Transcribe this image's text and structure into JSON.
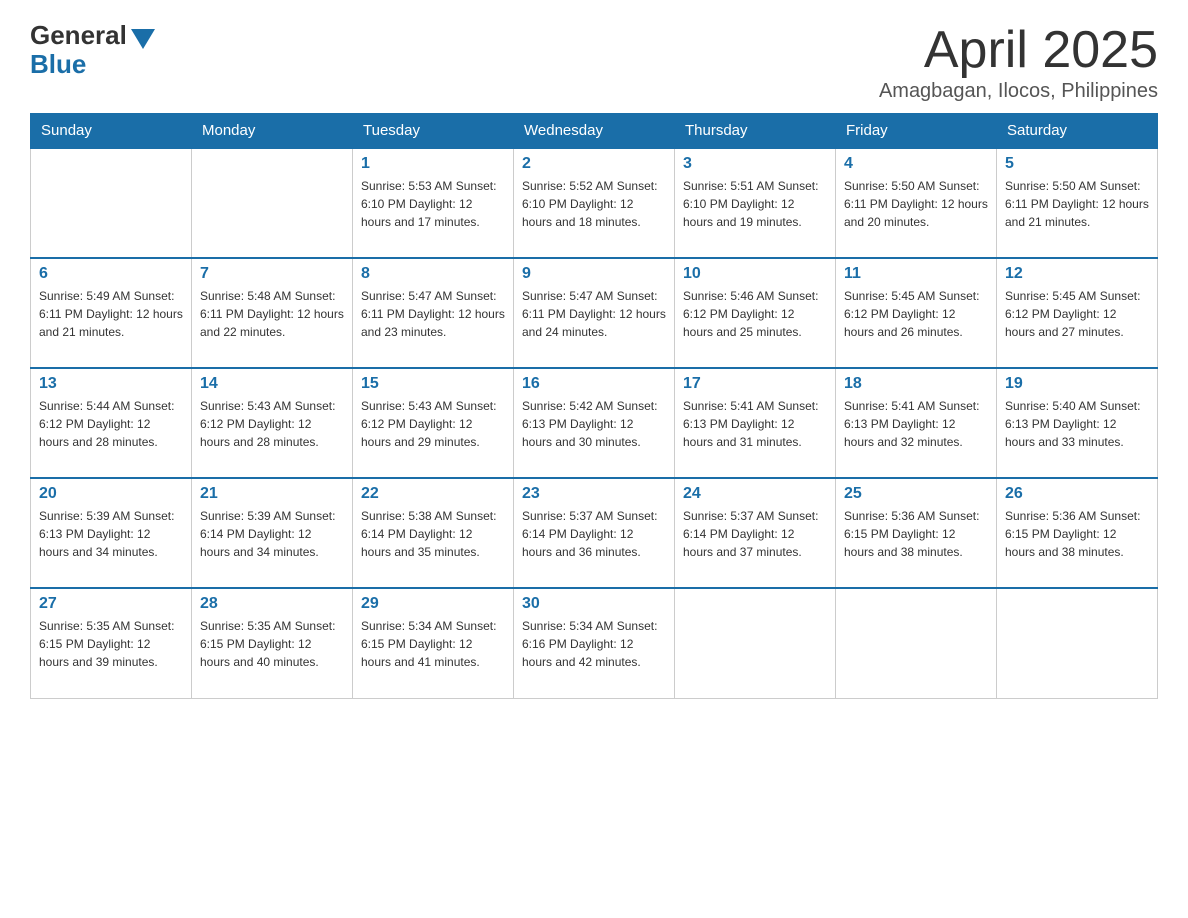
{
  "header": {
    "logo_general": "General",
    "logo_blue": "Blue",
    "month_title": "April 2025",
    "location": "Amagbagan, Ilocos, Philippines"
  },
  "days_of_week": [
    "Sunday",
    "Monday",
    "Tuesday",
    "Wednesday",
    "Thursday",
    "Friday",
    "Saturday"
  ],
  "weeks": [
    [
      {
        "day": "",
        "info": ""
      },
      {
        "day": "",
        "info": ""
      },
      {
        "day": "1",
        "info": "Sunrise: 5:53 AM\nSunset: 6:10 PM\nDaylight: 12 hours\nand 17 minutes."
      },
      {
        "day": "2",
        "info": "Sunrise: 5:52 AM\nSunset: 6:10 PM\nDaylight: 12 hours\nand 18 minutes."
      },
      {
        "day": "3",
        "info": "Sunrise: 5:51 AM\nSunset: 6:10 PM\nDaylight: 12 hours\nand 19 minutes."
      },
      {
        "day": "4",
        "info": "Sunrise: 5:50 AM\nSunset: 6:11 PM\nDaylight: 12 hours\nand 20 minutes."
      },
      {
        "day": "5",
        "info": "Sunrise: 5:50 AM\nSunset: 6:11 PM\nDaylight: 12 hours\nand 21 minutes."
      }
    ],
    [
      {
        "day": "6",
        "info": "Sunrise: 5:49 AM\nSunset: 6:11 PM\nDaylight: 12 hours\nand 21 minutes."
      },
      {
        "day": "7",
        "info": "Sunrise: 5:48 AM\nSunset: 6:11 PM\nDaylight: 12 hours\nand 22 minutes."
      },
      {
        "day": "8",
        "info": "Sunrise: 5:47 AM\nSunset: 6:11 PM\nDaylight: 12 hours\nand 23 minutes."
      },
      {
        "day": "9",
        "info": "Sunrise: 5:47 AM\nSunset: 6:11 PM\nDaylight: 12 hours\nand 24 minutes."
      },
      {
        "day": "10",
        "info": "Sunrise: 5:46 AM\nSunset: 6:12 PM\nDaylight: 12 hours\nand 25 minutes."
      },
      {
        "day": "11",
        "info": "Sunrise: 5:45 AM\nSunset: 6:12 PM\nDaylight: 12 hours\nand 26 minutes."
      },
      {
        "day": "12",
        "info": "Sunrise: 5:45 AM\nSunset: 6:12 PM\nDaylight: 12 hours\nand 27 minutes."
      }
    ],
    [
      {
        "day": "13",
        "info": "Sunrise: 5:44 AM\nSunset: 6:12 PM\nDaylight: 12 hours\nand 28 minutes."
      },
      {
        "day": "14",
        "info": "Sunrise: 5:43 AM\nSunset: 6:12 PM\nDaylight: 12 hours\nand 28 minutes."
      },
      {
        "day": "15",
        "info": "Sunrise: 5:43 AM\nSunset: 6:12 PM\nDaylight: 12 hours\nand 29 minutes."
      },
      {
        "day": "16",
        "info": "Sunrise: 5:42 AM\nSunset: 6:13 PM\nDaylight: 12 hours\nand 30 minutes."
      },
      {
        "day": "17",
        "info": "Sunrise: 5:41 AM\nSunset: 6:13 PM\nDaylight: 12 hours\nand 31 minutes."
      },
      {
        "day": "18",
        "info": "Sunrise: 5:41 AM\nSunset: 6:13 PM\nDaylight: 12 hours\nand 32 minutes."
      },
      {
        "day": "19",
        "info": "Sunrise: 5:40 AM\nSunset: 6:13 PM\nDaylight: 12 hours\nand 33 minutes."
      }
    ],
    [
      {
        "day": "20",
        "info": "Sunrise: 5:39 AM\nSunset: 6:13 PM\nDaylight: 12 hours\nand 34 minutes."
      },
      {
        "day": "21",
        "info": "Sunrise: 5:39 AM\nSunset: 6:14 PM\nDaylight: 12 hours\nand 34 minutes."
      },
      {
        "day": "22",
        "info": "Sunrise: 5:38 AM\nSunset: 6:14 PM\nDaylight: 12 hours\nand 35 minutes."
      },
      {
        "day": "23",
        "info": "Sunrise: 5:37 AM\nSunset: 6:14 PM\nDaylight: 12 hours\nand 36 minutes."
      },
      {
        "day": "24",
        "info": "Sunrise: 5:37 AM\nSunset: 6:14 PM\nDaylight: 12 hours\nand 37 minutes."
      },
      {
        "day": "25",
        "info": "Sunrise: 5:36 AM\nSunset: 6:15 PM\nDaylight: 12 hours\nand 38 minutes."
      },
      {
        "day": "26",
        "info": "Sunrise: 5:36 AM\nSunset: 6:15 PM\nDaylight: 12 hours\nand 38 minutes."
      }
    ],
    [
      {
        "day": "27",
        "info": "Sunrise: 5:35 AM\nSunset: 6:15 PM\nDaylight: 12 hours\nand 39 minutes."
      },
      {
        "day": "28",
        "info": "Sunrise: 5:35 AM\nSunset: 6:15 PM\nDaylight: 12 hours\nand 40 minutes."
      },
      {
        "day": "29",
        "info": "Sunrise: 5:34 AM\nSunset: 6:15 PM\nDaylight: 12 hours\nand 41 minutes."
      },
      {
        "day": "30",
        "info": "Sunrise: 5:34 AM\nSunset: 6:16 PM\nDaylight: 12 hours\nand 42 minutes."
      },
      {
        "day": "",
        "info": ""
      },
      {
        "day": "",
        "info": ""
      },
      {
        "day": "",
        "info": ""
      }
    ]
  ]
}
